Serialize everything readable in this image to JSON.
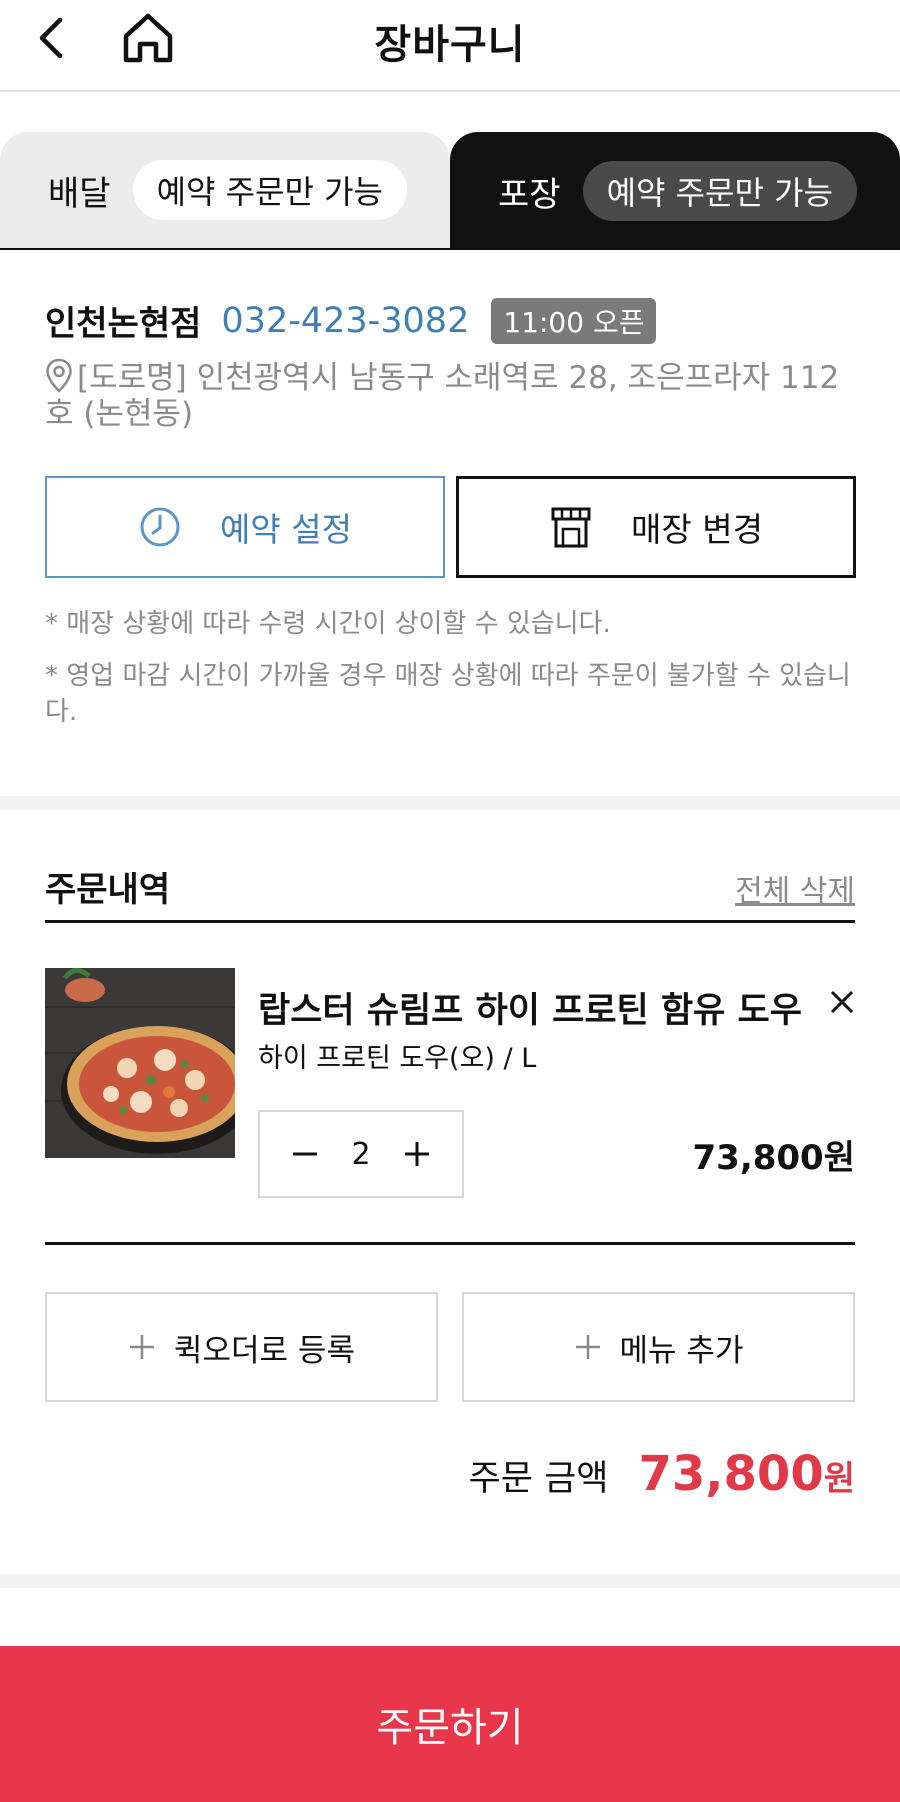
{
  "header": {
    "title": "장바구니"
  },
  "tabs": {
    "delivery": {
      "label": "배달",
      "pill": "예약 주문만 가능"
    },
    "pickup": {
      "label": "포장",
      "pill": "예약 주문만 가능"
    }
  },
  "store": {
    "name": "인천논현점",
    "phone": "032-423-3082",
    "open_badge": "11:00 오픈",
    "address": "[도로명] 인천광역시 남동구 소래역로 28, 조은프라자 112호 (논현동)",
    "reserve_label": "예약 설정",
    "change_label": "매장 변경",
    "notes": [
      "* 매장 상황에 따라 수령 시간이 상이할 수 있습니다.",
      "* 영업 마감 시간이 가까울 경우 매장 상황에 따라 주문이 불가할 수 있습니다."
    ]
  },
  "order": {
    "title": "주문내역",
    "clear_all": "전체 삭제",
    "item": {
      "name": "랍스터 슈림프 하이 프로틴 함유 도우",
      "option": "하이 프로틴 도우(오) / L",
      "quantity": "2",
      "price": "73,800원"
    },
    "quick_order_label": "퀵오더로 등록",
    "add_menu_label": "메뉴 추가",
    "total_label": "주문 금액",
    "total_amount": "73,800",
    "total_unit": "원"
  },
  "order_button": "주문하기",
  "colors": {
    "accent_blue": "#3f7fb5",
    "accent_red": "#e8374a",
    "price_red": "#e03a48"
  }
}
